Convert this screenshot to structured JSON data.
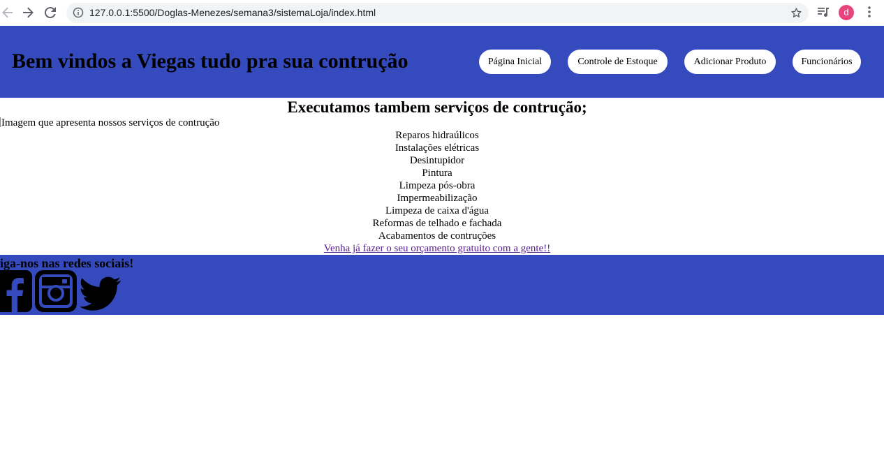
{
  "browser": {
    "url": "127.0.0.1:5500/Doglas-Menezes/semana3/sistemaLoja/index.html",
    "profile_initial": "d",
    "profile_color": "#e8457f"
  },
  "header": {
    "title": "Bem vindos a Viegas tudo pra sua contrução",
    "background": "#354abd",
    "nav": [
      {
        "label": "Página Inicial"
      },
      {
        "label": "Controle de Estoque"
      },
      {
        "label": "Adicionar Produto"
      },
      {
        "label": "Funcionários"
      }
    ]
  },
  "main": {
    "services_title": "Executamos tambem serviços de contrução;",
    "image_alt": "Imagem que apresenta nossos serviços de contrução",
    "services": [
      "Reparos hidraúlicos",
      "Instalações elétricas",
      "Desintupidor",
      "Pintura",
      "Limpeza pós-obra",
      "Impermeabilização",
      "Limpeza de caixa d'água",
      "Reformas de telhado e fachada",
      "Acabamentos de contruções"
    ],
    "quote_link": "Venha já fazer o seu orçamento gratuito com a gente!!"
  },
  "footer": {
    "text": "Siga-nos nas redes sociais!",
    "background": "#354abd",
    "social_icons": [
      "facebook-icon",
      "instagram-icon",
      "twitter-icon"
    ]
  }
}
